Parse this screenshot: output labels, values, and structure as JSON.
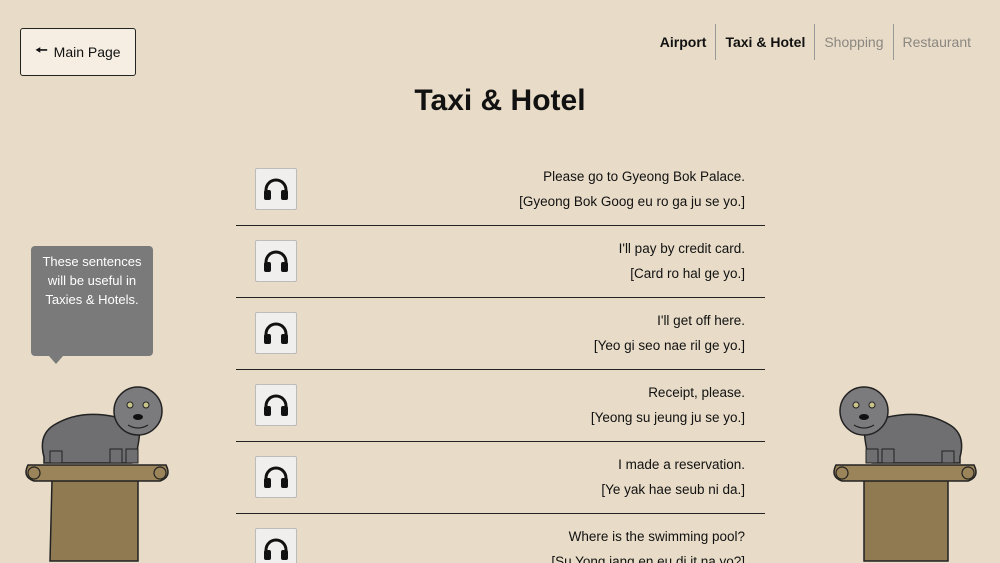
{
  "header": {
    "main_button_label": "Main Page",
    "page_title": "Taxi & Hotel"
  },
  "nav": [
    {
      "label": "Airport",
      "state": "active"
    },
    {
      "label": "Taxi & Hotel",
      "state": "active"
    },
    {
      "label": "Shopping",
      "state": "inactive"
    },
    {
      "label": "Restaurant",
      "state": "inactive"
    }
  ],
  "tooltip": {
    "text": "These sentences will be useful in Taxies & Hotels."
  },
  "phrases": [
    {
      "english": "Please go to Gyeong Bok Palace.",
      "korean": "[Gyeong Bok Goog eu ro ga ju se yo.]"
    },
    {
      "english": "I'll pay by credit card.",
      "korean": "[Card ro hal ge yo.]"
    },
    {
      "english": "I'll get off here.",
      "korean": "[Yeo gi seo nae ril ge yo.]"
    },
    {
      "english": "Receipt, please.",
      "korean": "[Yeong su jeung ju se yo.]"
    },
    {
      "english": "I made a reservation.",
      "korean": "[Ye yak hae seub ni da.]"
    },
    {
      "english": "Where is the swimming pool?",
      "korean": "[Su Yong jang en eu di it na yo?]"
    }
  ],
  "icons": {
    "audio": "headphones-icon",
    "back": "arrow-left-icon",
    "statue": "haetae-statue"
  },
  "colors": {
    "background": "#e8dcc8",
    "tooltip": "#7a7a7a",
    "pedestal": "#8f7a52"
  }
}
